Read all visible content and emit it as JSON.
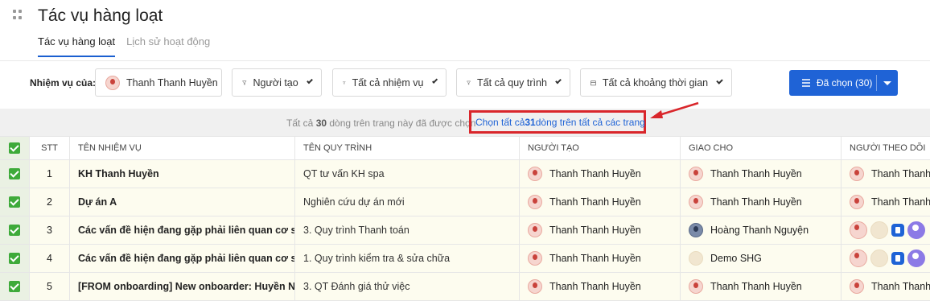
{
  "header": {
    "title": "Tác vụ hàng loạt",
    "tabs": [
      {
        "label": "Tác vụ hàng loạt",
        "active": true
      },
      {
        "label": "Lịch sử hoạt động",
        "active": false
      }
    ]
  },
  "filters": {
    "label": "Nhiệm vụ của:",
    "owner": "Thanh Thanh Huyền",
    "creator": "Người tạo",
    "tasks": "Tất cả nhiệm vụ",
    "processes": "Tất cả quy trình",
    "time": "Tất cả khoảng thời gian",
    "selected_button": "Đã chọn (30)"
  },
  "notice": {
    "prefix": "Tất cả ",
    "count_page": "30",
    "suffix": " dòng trên trang này đã được chọn",
    "select_all_prefix": "Chọn tất cả ",
    "count_all": "31",
    "select_all_suffix": " dòng trên tất cả các trang"
  },
  "table": {
    "columns": [
      "STT",
      "TÊN NHIỆM VỤ",
      "TÊN QUY TRÌNH",
      "NGƯỜI TẠO",
      "GIAO CHO",
      "NGƯỜI THEO DÕI"
    ],
    "rows": [
      {
        "stt": "1",
        "task": "KH Thanh Huyền",
        "process": "QT tư vấn KH spa",
        "creator": "Thanh Thanh Huyền",
        "assignee": "Thanh Thanh Huyền",
        "follower": "Thanh Thanh Huyền"
      },
      {
        "stt": "2",
        "task": "Dự án A",
        "process": "Nghiên cứu dự án mới",
        "creator": "Thanh Thanh Huyền",
        "assignee": "Thanh Thanh Huyền",
        "follower": "Thanh Thanh Huyền"
      },
      {
        "stt": "3",
        "task": "Các vấn đề hiện đang gặp phải liên quan cơ sở",
        "process": "3. Quy trình Thanh toán",
        "creator": "Thanh Thanh Huyền",
        "assignee": "Hoàng Thanh Nguyện",
        "follower": ""
      },
      {
        "stt": "4",
        "task": "Các vấn đề hiện đang gặp phải liên quan cơ sở",
        "process": "1. Quy trình kiểm tra & sửa chữa",
        "creator": "Thanh Thanh Huyền",
        "assignee": "Demo SHG",
        "follower": ""
      },
      {
        "stt": "5",
        "task": "[FROM onboarding] New onboarder: Huyền Ng",
        "process": "3. QT Đánh giá thử việc",
        "creator": "Thanh Thanh Huyền",
        "assignee": "Thanh Thanh Huyền",
        "follower": "Thanh Thanh Huyền"
      }
    ]
  }
}
